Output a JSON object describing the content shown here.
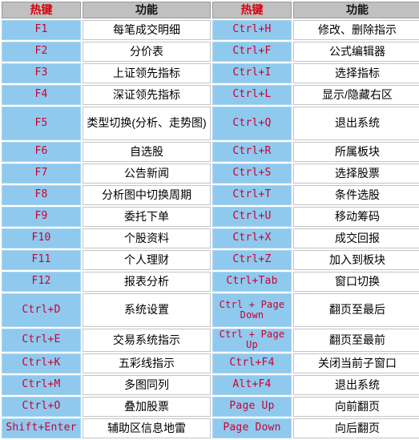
{
  "table": {
    "headers": {
      "hotkey": "热键",
      "function": "功能"
    },
    "left_column": [
      {
        "key": "F1",
        "fn": "每笔成交明细",
        "tall": false
      },
      {
        "key": "F2",
        "fn": "分价表",
        "tall": false
      },
      {
        "key": "F3",
        "fn": "上证领先指标",
        "tall": false
      },
      {
        "key": "F4",
        "fn": "深证领先指标",
        "tall": false
      },
      {
        "key": "F5",
        "fn": "类型切换(分析、走势图)",
        "tall": true
      },
      {
        "key": "F6",
        "fn": "自选股",
        "tall": false
      },
      {
        "key": "F7",
        "fn": "公告新闻",
        "tall": false
      },
      {
        "key": "F8",
        "fn": "分析图中切换周期",
        "tall": false
      },
      {
        "key": "F9",
        "fn": "委托下单",
        "tall": false
      },
      {
        "key": "F10",
        "fn": "个股资料",
        "tall": false
      },
      {
        "key": "F11",
        "fn": "个人理财",
        "tall": false
      },
      {
        "key": "F12",
        "fn": "报表分析",
        "tall": false
      },
      {
        "key": "Ctrl+D",
        "fn": "系统设置",
        "tall": true
      },
      {
        "key": "Ctrl+E",
        "fn": "交易系统指示",
        "tall": false
      },
      {
        "key": "Ctrl+K",
        "fn": "五彩线指示",
        "tall": false
      },
      {
        "key": "Ctrl+M",
        "fn": "多图同列",
        "tall": false
      },
      {
        "key": "Ctrl+O",
        "fn": "叠加股票",
        "tall": false
      },
      {
        "key": "Shift+Enter",
        "fn": "辅助区信息地雷",
        "tall": false
      }
    ],
    "right_column": [
      {
        "key": "Ctrl+H",
        "fn": "修改、删除指示",
        "tall": false
      },
      {
        "key": "Ctrl+F",
        "fn": "公式编辑器",
        "tall": false
      },
      {
        "key": "Ctrl+I",
        "fn": "选择指标",
        "tall": false
      },
      {
        "key": "Ctrl+L",
        "fn": "显示/隐藏右区",
        "tall": false
      },
      {
        "key": "Ctrl+Q",
        "fn": "退出系统",
        "tall": true
      },
      {
        "key": "Ctrl+R",
        "fn": "所属板块",
        "tall": false
      },
      {
        "key": "Ctrl+S",
        "fn": "选择股票",
        "tall": false
      },
      {
        "key": "Ctrl+T",
        "fn": "条件选股",
        "tall": false
      },
      {
        "key": "Ctrl+U",
        "fn": "移动筹码",
        "tall": false
      },
      {
        "key": "Ctrl+X",
        "fn": "成交回报",
        "tall": false
      },
      {
        "key": "Ctrl+Z",
        "fn": "加入到板块",
        "tall": false
      },
      {
        "key": "Ctrl+Tab",
        "fn": "窗口切换",
        "tall": false
      },
      {
        "key": "Ctrl + Page Down",
        "fn": "翻页至最后",
        "tall": true
      },
      {
        "key": "Ctrl + Page Up",
        "fn": "翻页至最前",
        "tall": false
      },
      {
        "key": "Ctrl+F4",
        "fn": "关闭当前子窗口",
        "tall": false
      },
      {
        "key": "Alt+F4",
        "fn": "退出系统",
        "tall": false
      },
      {
        "key": "Page Up",
        "fn": "向前翻页",
        "tall": false
      },
      {
        "key": "Page Down",
        "fn": "向后翻页",
        "tall": false
      }
    ],
    "colors": {
      "header_bg": "#c0c0c0",
      "hotkey_bg": "#8fc9ee",
      "hotkey_text": "#cc0033",
      "function_bg": "#ffffff",
      "function_text": "#000000",
      "header_hotkey_text": "#d8000c"
    }
  }
}
